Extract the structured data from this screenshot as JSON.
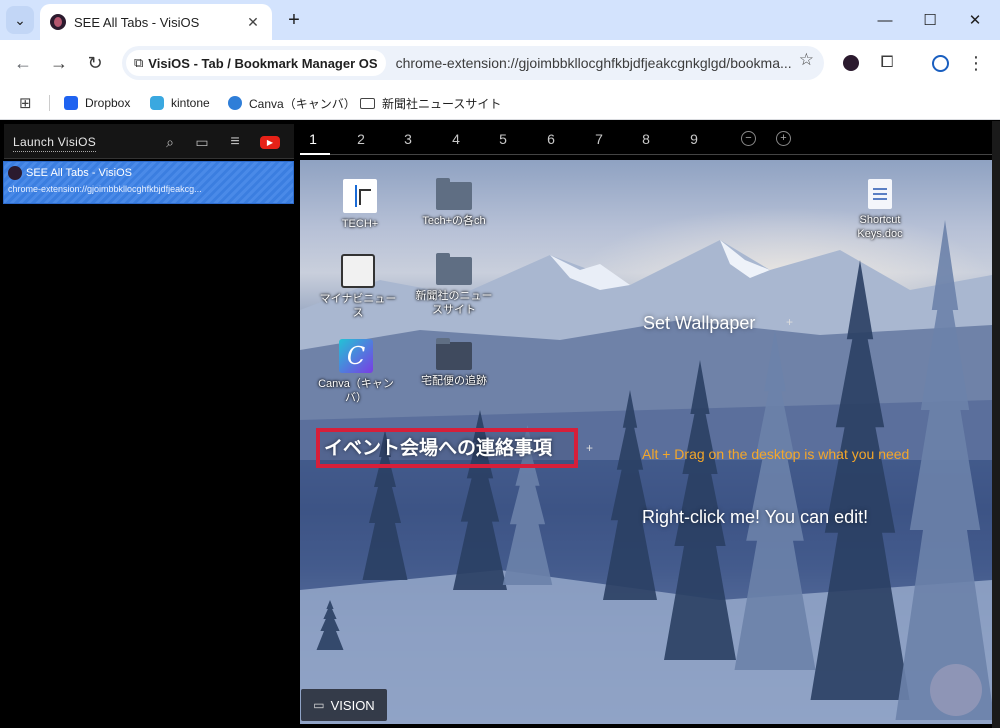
{
  "browser": {
    "tab_title": "SEE All Tabs - VisiOS",
    "tab_close": "✕",
    "new_tab": "+",
    "window": {
      "minimize": "—",
      "maximize": "☐",
      "close": "✕"
    },
    "omnibox": {
      "chip_label": "VisiOS - Tab / Bookmark Manager OS",
      "url": "chrome-extension://gjoimbbkllocghfkbjdfjeakcgnkglgd/bookma..."
    },
    "bookmarks": [
      "Dropbox",
      "kintone",
      "Canva（キャンバ）",
      "新聞社ニュースサイト"
    ]
  },
  "sidebar": {
    "launch_label": "Launch VisiOS",
    "tab_item": {
      "title": "SEE All Tabs - VisiOS",
      "url": "chrome-extension://gjoimbbkllocghfkbjdfjeakcg..."
    }
  },
  "desktop_tabs": [
    "1",
    "2",
    "3",
    "4",
    "5",
    "6",
    "7",
    "8",
    "9"
  ],
  "desktop": {
    "icons": {
      "techplus": "TECH+",
      "techplus_folder": "Tech+の各ch",
      "mynavi": "マイナビニュース",
      "newspaper": "新聞社のニュースサイト",
      "canva": "Canva（キャンバ）",
      "delivery": "宅配便の追跡",
      "shortcut": "Shortcut Keys.doc"
    },
    "set_wallpaper": "Set Wallpaper",
    "note": "イベント会場への連絡事項",
    "alt_drag": "Alt + Drag on the desktop is what you need",
    "right_click": "Right-click me! You can edit!",
    "plus": "+"
  },
  "vision_button": "VISION",
  "colors": {
    "chrome_frame": "#d3e3fd",
    "selected_tab": "#3b7ee0",
    "note_border": "#d61f3a",
    "hint_orange": "#f4a72a"
  }
}
